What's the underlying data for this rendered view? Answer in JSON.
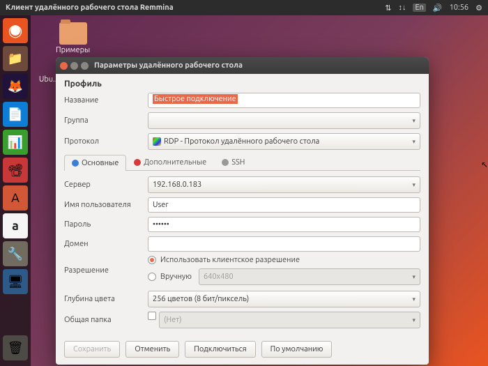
{
  "topbar": {
    "title": "Клиент удалённого рабочего стола Remmina",
    "lang": "En",
    "time": "10:56"
  },
  "desktop": {
    "examples": "Примеры",
    "ubuntu": "Ubu..."
  },
  "dialog": {
    "title": "Параметры удалённого рабочего стола",
    "profile_section": "Профиль",
    "labels": {
      "name": "Название",
      "group": "Группа",
      "protocol": "Протокол",
      "server": "Сервер",
      "username": "Имя пользователя",
      "password": "Пароль",
      "domain": "Домен",
      "resolution": "Разрешение",
      "color_depth": "Глубина цвета",
      "shared_folder": "Общая папка"
    },
    "values": {
      "name": "Быстрое подключение",
      "protocol": "RDP - Протокол удалённого рабочего стола",
      "server": "192.168.0.183",
      "username": "User",
      "password": "••••••",
      "resolution_client": "Использовать клиентское разрешение",
      "resolution_manual": "Вручную",
      "resolution_manual_value": "640x480",
      "color_depth": "256 цветов (8 бит/пиксель)",
      "shared_folder_placeholder": "(Нет)"
    },
    "tabs": {
      "basic": "Основные",
      "advanced": "Дополнительные",
      "ssh": "SSH"
    },
    "buttons": {
      "save": "Сохранить",
      "cancel": "Отменить",
      "connect": "Подключиться",
      "default": "По умолчанию"
    }
  }
}
